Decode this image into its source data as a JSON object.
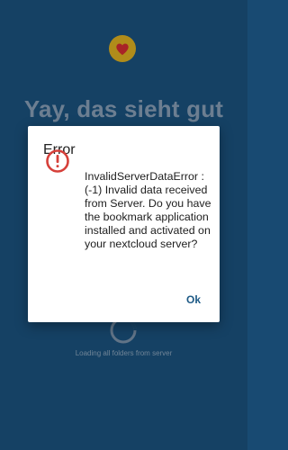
{
  "background": {
    "title": "Yay, das sieht gut",
    "loading_text": "Loading all folders from server",
    "heart_icon": "heart-icon",
    "spinner_icon": "loading-spinner-icon",
    "bg_color": "#184a72",
    "heart_circle_color": "#c9a01e",
    "heart_color": "#c0282d"
  },
  "dialog": {
    "title": "Error",
    "icon": "error-circle-icon",
    "icon_color": "#d6403a",
    "message": "InvalidServerDataError : (-1) Invalid data received from Server. Do you have the bookmark application installed and activated on your nextcloud server?",
    "ok_label": "Ok",
    "accent_color": "#1e5a86"
  }
}
